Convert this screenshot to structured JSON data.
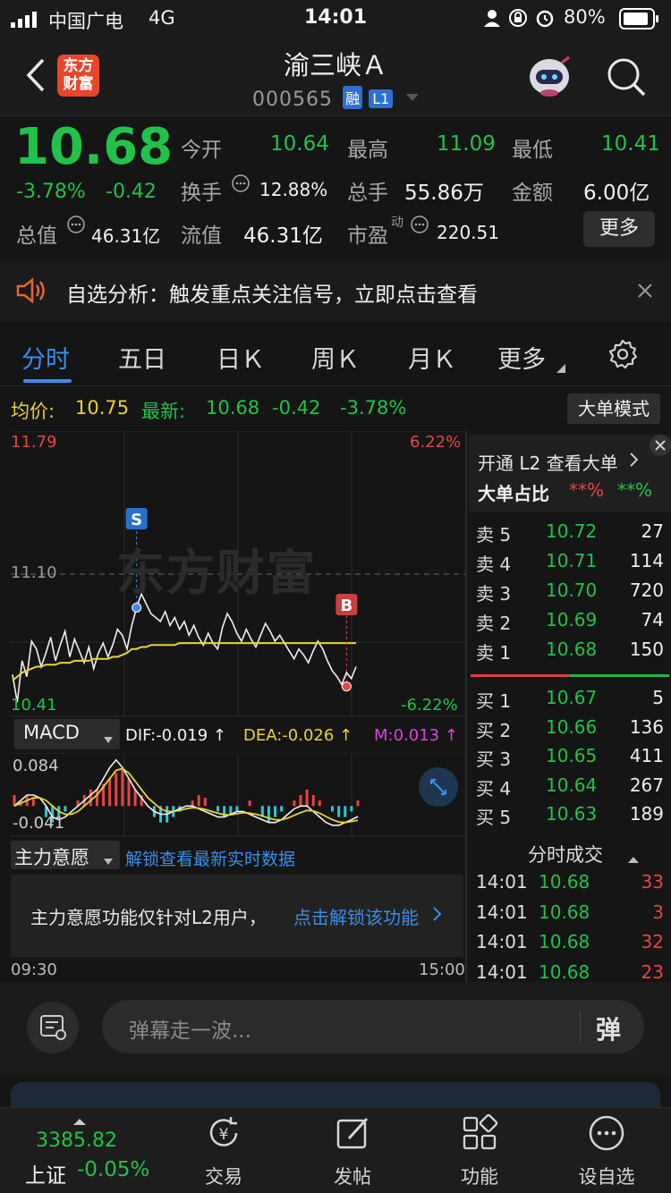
{
  "status_bar": {
    "carrier": "中国广电",
    "network": "4G",
    "time": "14:01",
    "battery": "80%"
  },
  "header": {
    "logo_text": "东方\n财富",
    "title": "渝三峡Ａ",
    "code": "000565",
    "badge_rong": "融",
    "badge_level": "L1"
  },
  "quote": {
    "price": "10.68",
    "change_pct": "-3.78%",
    "change": "-0.42",
    "open_label": "今开",
    "open": "10.64",
    "high_label": "最高",
    "high": "11.09",
    "low_label": "最低",
    "low": "10.41",
    "turnover_label": "换手",
    "turnover": "12.88%",
    "volume_label": "总手",
    "volume": "55.86万",
    "amount_label": "金额",
    "amount": "6.00亿",
    "total_value_label": "总值",
    "total_value": "46.31亿",
    "float_value_label": "流值",
    "float_value": "46.31亿",
    "pe_label": "市盈",
    "pe_sup": "动",
    "pe": "220.51",
    "more_button": "更多"
  },
  "notice": {
    "text": "自选分析：触发重点关注信号，立即点击查看"
  },
  "tabs": {
    "items": [
      "分时",
      "五日",
      "日Ｋ",
      "周Ｋ",
      "月Ｋ",
      "更多"
    ],
    "active": 0
  },
  "chart_info": {
    "avg_label": "均价:",
    "avg": "10.75",
    "latest_label": "最新:",
    "latest": "10.68",
    "change": "-0.42",
    "change_pct": "-3.78%",
    "big_order_mode": "大单模式"
  },
  "chart_data": [
    {
      "type": "line",
      "title": "",
      "y_left_max": "11.79",
      "y_left_mid": "11.10",
      "y_left_min": "10.41",
      "y_right_max": "6.22%",
      "y_right_min": "-6.22%",
      "ylim": [
        10.41,
        11.79
      ],
      "x_start": "09:30",
      "x_end": "15:00",
      "watermark": "东方财富",
      "markers": [
        {
          "label": "S",
          "value": 10.93
        },
        {
          "label": "B",
          "value": 10.53
        }
      ],
      "series": [
        {
          "values": [
            10.59,
            10.45,
            10.66,
            10.58,
            10.76,
            10.72,
            10.63,
            10.7,
            10.78,
            10.66,
            10.74,
            10.81,
            10.68,
            10.77,
            10.71,
            10.65,
            10.73,
            10.62,
            10.7,
            10.75,
            10.68,
            10.74,
            10.82,
            10.79,
            10.72,
            10.84,
            10.93,
            11.0,
            10.95,
            10.9,
            10.88,
            10.86,
            10.91,
            10.84,
            10.88,
            10.82,
            10.86,
            10.79,
            10.84,
            10.78,
            10.74,
            10.8,
            10.75,
            10.72,
            10.83,
            10.9,
            10.86,
            10.8,
            10.76,
            10.82,
            10.77,
            10.73,
            10.79,
            10.85,
            10.81,
            10.76,
            10.79,
            10.75,
            10.71,
            10.67,
            10.72,
            10.69,
            10.65,
            10.71,
            10.76,
            10.72,
            10.66,
            10.61,
            10.58,
            10.54,
            10.6,
            10.57,
            10.63
          ]
        },
        {
          "values": [
            10.56,
            10.58,
            10.6,
            10.61,
            10.62,
            10.63,
            10.63,
            10.64,
            10.64,
            10.64,
            10.65,
            10.65,
            10.65,
            10.66,
            10.66,
            10.66,
            10.66,
            10.67,
            10.67,
            10.67,
            10.67,
            10.68,
            10.68,
            10.69,
            10.7,
            10.72,
            10.72,
            10.73,
            10.73,
            10.74,
            10.74,
            10.74,
            10.74,
            10.74,
            10.74,
            10.75,
            10.75,
            10.75,
            10.75,
            10.75,
            10.75,
            10.75,
            10.75,
            10.75,
            10.75,
            10.75,
            10.75,
            10.75,
            10.75,
            10.75,
            10.75,
            10.75,
            10.75,
            10.75,
            10.75,
            10.75,
            10.75,
            10.75,
            10.75,
            10.75,
            10.75,
            10.75,
            10.75,
            10.75,
            10.75,
            10.75,
            10.75,
            10.75,
            10.75,
            10.75,
            10.75,
            10.75,
            10.75
          ]
        }
      ]
    },
    {
      "type": "bar",
      "title": "",
      "indicator": "MACD",
      "dif_label": "DIF:-0.019 ↑",
      "dea_label": "DEA:-0.026 ↑",
      "m_label": "M:0.013 ↑",
      "y_max": "0.084",
      "y_min": "-0.041",
      "ylim": [
        -0.05,
        0.09
      ],
      "series": [
        {
          "values": [
            0.02,
            0.01,
            0.02,
            0.015,
            0.0,
            -0.02,
            -0.03,
            -0.02,
            -0.01,
            0.0,
            0.01,
            0.02,
            0.03,
            0.03,
            0.04,
            0.05,
            0.06,
            0.07,
            0.05,
            0.03,
            0.02,
            0.0,
            -0.02,
            -0.03,
            -0.03,
            -0.02,
            -0.01,
            0.0,
            0.01,
            0.02,
            0.015,
            0.0,
            -0.01,
            -0.02,
            -0.015,
            -0.01,
            0.0,
            0.01,
            0.0,
            -0.02,
            -0.03,
            -0.02,
            -0.01,
            0.0,
            0.01,
            0.02,
            0.03,
            0.02,
            0.01,
            0.0,
            -0.01,
            -0.02,
            -0.02,
            -0.01,
            0.01
          ]
        },
        {
          "values": [
            0.0,
            0.01,
            0.02,
            0.02,
            0.015,
            0.0,
            -0.02,
            -0.025,
            -0.02,
            -0.01,
            0.0,
            0.01,
            0.02,
            0.03,
            0.05,
            0.07,
            0.084,
            0.07,
            0.05,
            0.03,
            0.015,
            0.0,
            -0.01,
            -0.015,
            -0.015,
            -0.01,
            -0.005,
            0.0,
            0.0,
            -0.005,
            -0.01,
            -0.015,
            -0.02,
            -0.02,
            -0.015,
            -0.01,
            -0.01,
            -0.015,
            -0.02,
            -0.025,
            -0.03,
            -0.03,
            -0.025,
            -0.015,
            -0.005,
            0.0,
            0.0,
            -0.01,
            -0.02,
            -0.03,
            -0.035,
            -0.035,
            -0.03,
            -0.025,
            -0.019
          ]
        },
        {
          "values": [
            0.0,
            0.005,
            0.01,
            0.015,
            0.015,
            0.01,
            0.0,
            -0.01,
            -0.015,
            -0.015,
            -0.01,
            0.0,
            0.01,
            0.02,
            0.035,
            0.05,
            0.065,
            0.068,
            0.06,
            0.045,
            0.03,
            0.015,
            0.005,
            -0.005,
            -0.01,
            -0.01,
            -0.008,
            -0.005,
            -0.003,
            -0.004,
            -0.006,
            -0.01,
            -0.013,
            -0.016,
            -0.016,
            -0.014,
            -0.012,
            -0.013,
            -0.015,
            -0.018,
            -0.022,
            -0.025,
            -0.025,
            -0.022,
            -0.017,
            -0.012,
            -0.008,
            -0.009,
            -0.013,
            -0.019,
            -0.025,
            -0.029,
            -0.03,
            -0.028,
            -0.026
          ]
        }
      ]
    }
  ],
  "intent": {
    "selector": "主力意愿",
    "link": "解锁查看最新实时数据",
    "message": "主力意愿功能仅针对L2用户，",
    "unlock": "点击解锁该功能"
  },
  "orderbook": {
    "l2_link": "开通 L2 查看大单",
    "ratio_label": "大单占比",
    "ratio_buy": "**%",
    "ratio_sell": "**%",
    "asks": [
      {
        "label": "卖 5",
        "price": "10.72",
        "vol": "27"
      },
      {
        "label": "卖 4",
        "price": "10.71",
        "vol": "114"
      },
      {
        "label": "卖 3",
        "price": "10.70",
        "vol": "720"
      },
      {
        "label": "卖 2",
        "price": "10.69",
        "vol": "74"
      },
      {
        "label": "卖 1",
        "price": "10.68",
        "vol": "150"
      }
    ],
    "bids": [
      {
        "label": "买 1",
        "price": "10.67",
        "vol": "5"
      },
      {
        "label": "买 2",
        "price": "10.66",
        "vol": "136"
      },
      {
        "label": "买 3",
        "price": "10.65",
        "vol": "411"
      },
      {
        "label": "买 4",
        "price": "10.64",
        "vol": "267"
      },
      {
        "label": "买 5",
        "price": "10.63",
        "vol": "189"
      }
    ],
    "ticks_title": "分时成交",
    "ticks": [
      {
        "time": "14:01",
        "price": "10.68",
        "vol": "33"
      },
      {
        "time": "14:01",
        "price": "10.68",
        "vol": "3"
      },
      {
        "time": "14:01",
        "price": "10.68",
        "vol": "32"
      },
      {
        "time": "14:01",
        "price": "10.68",
        "vol": "23"
      }
    ]
  },
  "danmu": {
    "placeholder": "弹幕走一波...",
    "send_label": "弹"
  },
  "bottom": {
    "index_value": "3385.82",
    "index_name": "上证",
    "index_change": "-0.05%",
    "items": [
      "交易",
      "发帖",
      "功能",
      "设自选"
    ],
    "trade_symbol": "¥"
  }
}
